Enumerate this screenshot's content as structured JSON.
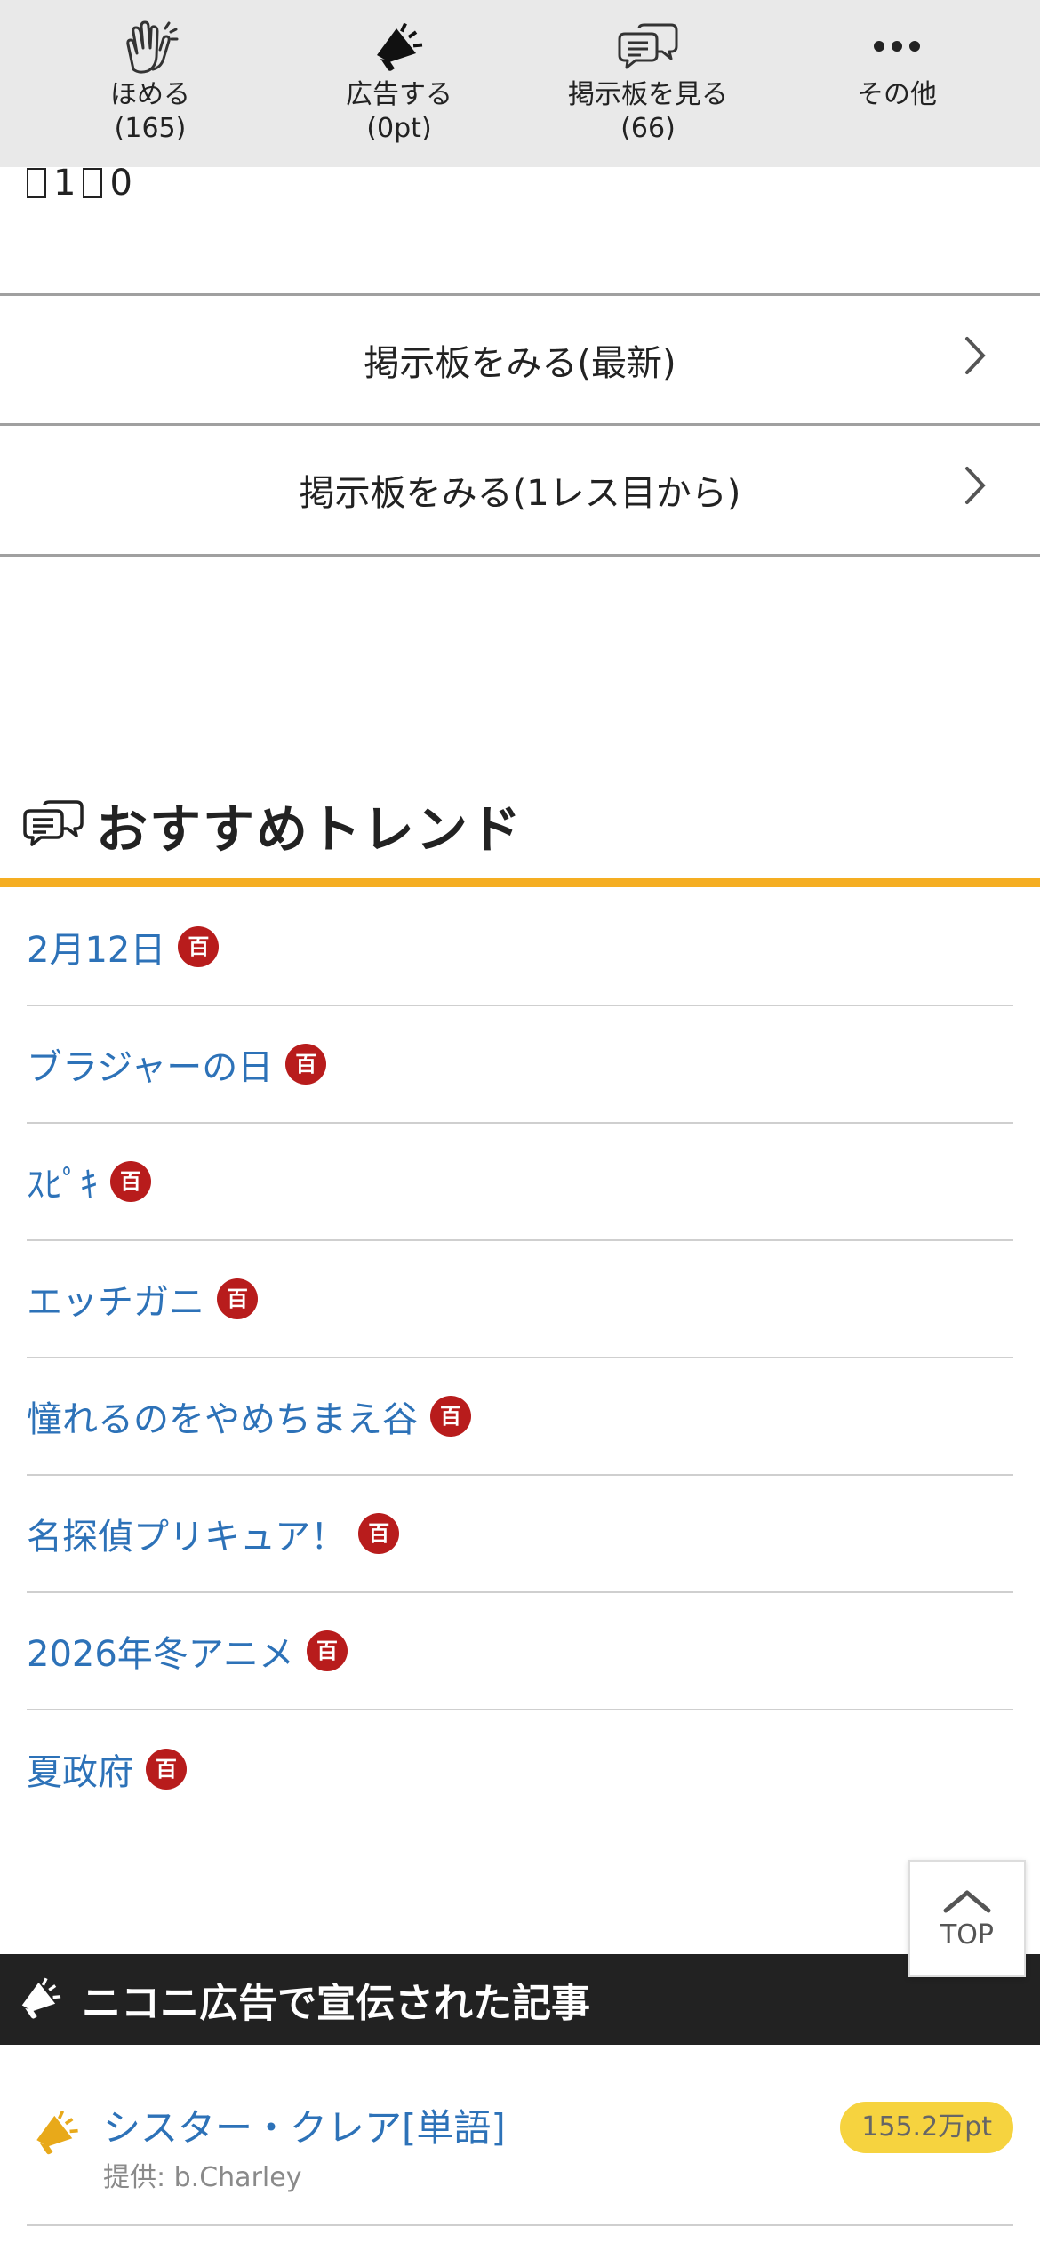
{
  "action_bar": {
    "items": [
      {
        "label": "ほめる",
        "count": "(165)",
        "icon": "clapping-hands-icon"
      },
      {
        "label": "広告する",
        "count": "(0pt)",
        "icon": "megaphone-icon"
      },
      {
        "label": "掲示板を見る",
        "count": "(66)",
        "icon": "chat-bubbles-icon"
      },
      {
        "label": "その他",
        "count": "",
        "icon": "more-dots-icon"
      }
    ]
  },
  "counter": {
    "value_a": "1",
    "value_b": "0"
  },
  "board_links": [
    {
      "label": "掲示板をみる(最新)"
    },
    {
      "label": "掲示板をみる(1レス目から)"
    }
  ],
  "trends": {
    "title": "おすすめトレンド",
    "badge_text": "百",
    "items": [
      {
        "label": "2月12日"
      },
      {
        "label": "ブラジャーの日"
      },
      {
        "label": "ｽﾋﾟｷ"
      },
      {
        "label": "エッチガニ"
      },
      {
        "label": "憧れるのをやめちまえ谷"
      },
      {
        "label": "名探偵プリキュア！"
      },
      {
        "label": "2026年冬アニメ"
      },
      {
        "label": "夏政府"
      }
    ]
  },
  "top_button": {
    "label": "TOP"
  },
  "nico_ad": {
    "title": "ニコニ広告で宣伝された記事",
    "items": [
      {
        "title": "シスター・クレア[単語]",
        "provider": "提供: b.Charley",
        "points": "155.2万pt"
      }
    ]
  },
  "colors": {
    "link": "#2d72b8",
    "accent": "#f5ae22",
    "badge": "#b81c1c",
    "ad_header_bg": "#222222",
    "points_pill": "#f6d33f"
  }
}
